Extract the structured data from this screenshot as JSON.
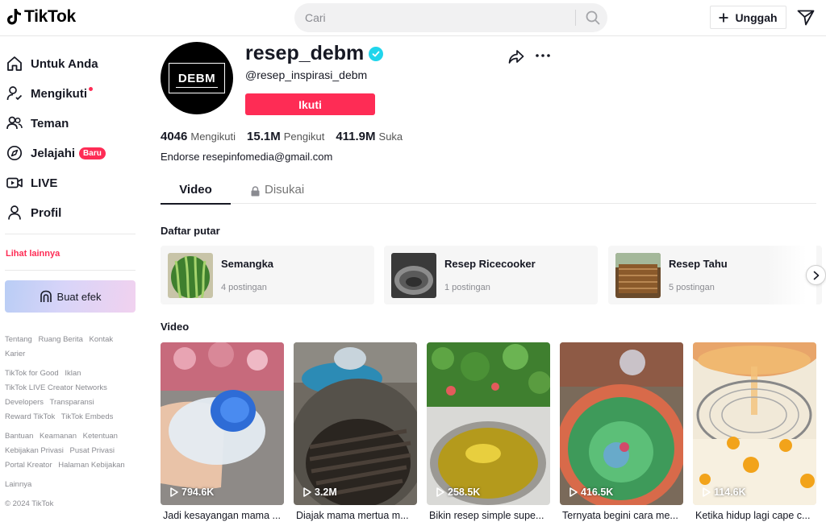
{
  "header": {
    "logo_text": "TikTok",
    "search_placeholder": "Cari",
    "upload_label": "Unggah"
  },
  "sidebar": {
    "items": [
      {
        "label": "Untuk Anda",
        "icon": "home-icon"
      },
      {
        "label": "Mengikuti",
        "icon": "following-icon",
        "dot": true
      },
      {
        "label": "Teman",
        "icon": "friends-icon"
      },
      {
        "label": "Jelajahi",
        "icon": "compass-icon",
        "badge": "Baru"
      },
      {
        "label": "LIVE",
        "icon": "live-icon"
      },
      {
        "label": "Profil",
        "icon": "profile-icon"
      }
    ],
    "see_more": "Lihat lainnya",
    "create_effect": "Buat efek",
    "footer_groups": [
      [
        "Tentang",
        "Ruang Berita",
        "Kontak",
        "Karier"
      ],
      [
        "TikTok for Good",
        "Iklan",
        "TikTok LIVE Creator Networks",
        "Developers",
        "Transparansi",
        "Reward TikTok",
        "TikTok Embeds"
      ],
      [
        "Bantuan",
        "Keamanan",
        "Ketentuan",
        "Kebijakan Privasi",
        "Pusat Privasi",
        "Portal Kreator",
        "Halaman Kebijakan"
      ],
      [
        "Lainnya"
      ]
    ],
    "copyright": "© 2024 TikTok"
  },
  "profile": {
    "avatar_text": "DEBM",
    "username": "resep_debm",
    "handle": "@resep_inspirasi_debm",
    "follow_label": "Ikuti",
    "stats": {
      "following_count": "4046",
      "following_label": "Mengikuti",
      "followers_count": "15.1M",
      "followers_label": "Pengikut",
      "likes_count": "411.9M",
      "likes_label": "Suka"
    },
    "bio": "Endorse resepinfomedia@gmail.com"
  },
  "tabs": {
    "videos": "Video",
    "liked": "Disukai"
  },
  "playlists_title": "Daftar putar",
  "playlists": [
    {
      "name": "Semangka",
      "count": "4 postingan"
    },
    {
      "name": "Resep Ricecooker",
      "count": "1 postingan"
    },
    {
      "name": "Resep Tahu",
      "count": "5 postingan"
    }
  ],
  "videos_title": "Video",
  "videos": [
    {
      "views": "794.6K",
      "caption": "Jadi kesayangan mama ..."
    },
    {
      "views": "3.2M",
      "caption": "Diajak mama mertua m..."
    },
    {
      "views": "258.5K",
      "caption": "Bikin resep simple supe..."
    },
    {
      "views": "416.5K",
      "caption": "Ternyata begini cara me..."
    },
    {
      "views": "114.6K",
      "caption": "Ketika hidup lagi cape c..."
    }
  ],
  "colors": {
    "accent": "#fe2c55",
    "verified": "#20d5ec"
  }
}
